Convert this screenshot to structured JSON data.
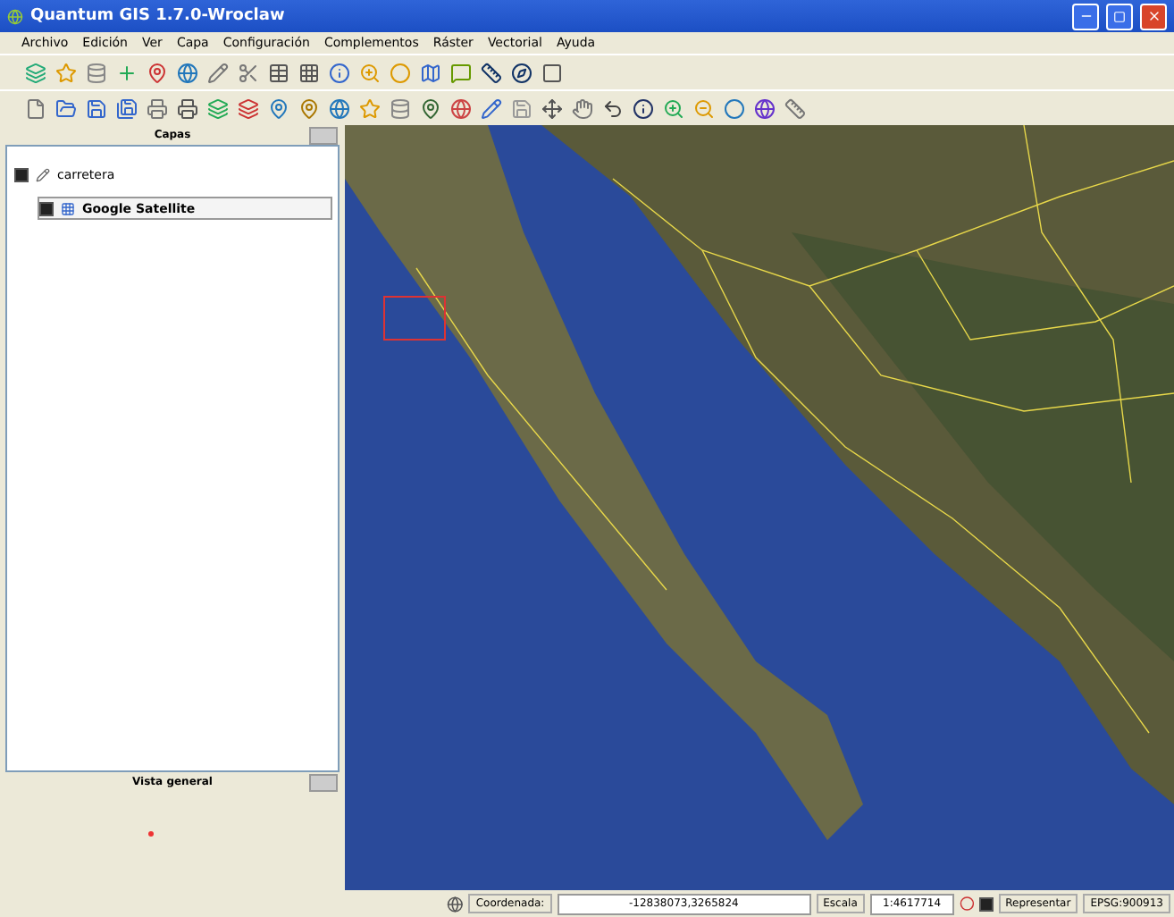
{
  "window": {
    "title": "Quantum GIS 1.7.0-Wroclaw"
  },
  "menu": [
    "Archivo",
    "Edición",
    "Ver",
    "Capa",
    "Configuración",
    "Complementos",
    "Ráster",
    "Vectorial",
    "Ayuda"
  ],
  "layers_panel": {
    "title": "Capas",
    "layers": [
      {
        "name": "carretera",
        "checked": true,
        "selected": false,
        "kind": "vector"
      },
      {
        "name": "Google Satellite",
        "checked": true,
        "selected": true,
        "kind": "raster"
      }
    ]
  },
  "overview_panel": {
    "title": "Vista general"
  },
  "status_bar": {
    "coordinate_label": "Coordenada:",
    "coordinate": "-12838073,3265824",
    "scale_label": "Escala",
    "scale": "1:4617714",
    "render_label": "Representar",
    "render": true,
    "crs": "EPSG:900913"
  }
}
